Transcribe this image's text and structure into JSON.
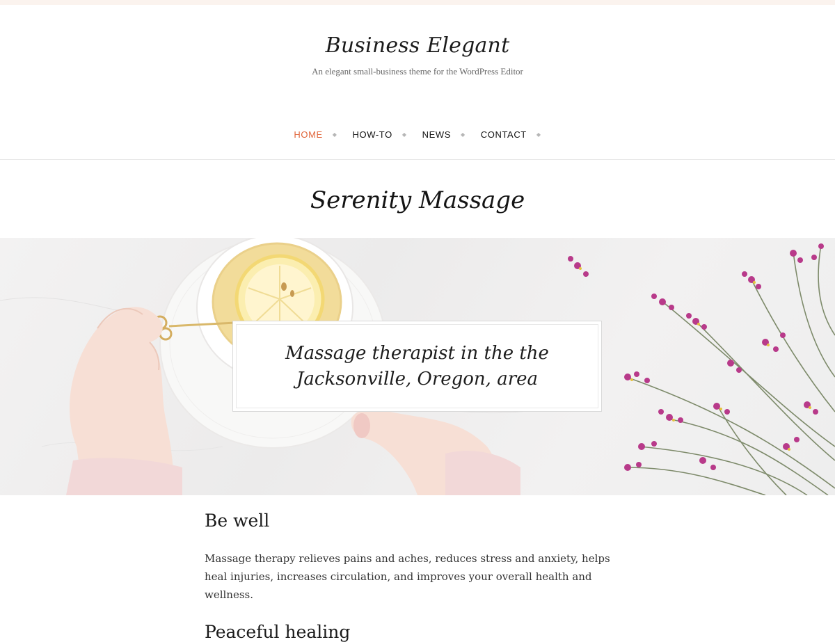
{
  "site": {
    "title": "Business Elegant",
    "tagline": "An elegant small-business theme for the WordPress Editor"
  },
  "nav": {
    "items": [
      {
        "label": "HOME",
        "active": true
      },
      {
        "label": "HOW-TO",
        "active": false
      },
      {
        "label": "NEWS",
        "active": false
      },
      {
        "label": "CONTACT",
        "active": false
      }
    ],
    "separator_icon": "diamond-icon"
  },
  "page": {
    "title": "Serenity Massage"
  },
  "hero": {
    "image": "tea-hands-flowers-photo",
    "caption": "Massage therapist in the the Jacksonville, Oregon, area"
  },
  "content": {
    "sections": [
      {
        "heading": "Be well",
        "body": "Massage therapy relieves pains and aches, reduces stress and anxiety, helps heal injuries, increases circulation, and improves your overall health and wellness."
      },
      {
        "heading": "Peaceful healing"
      }
    ]
  },
  "colors": {
    "accent": "#e0653a",
    "top_bar": "#fbf3ee",
    "text": "#222222"
  }
}
